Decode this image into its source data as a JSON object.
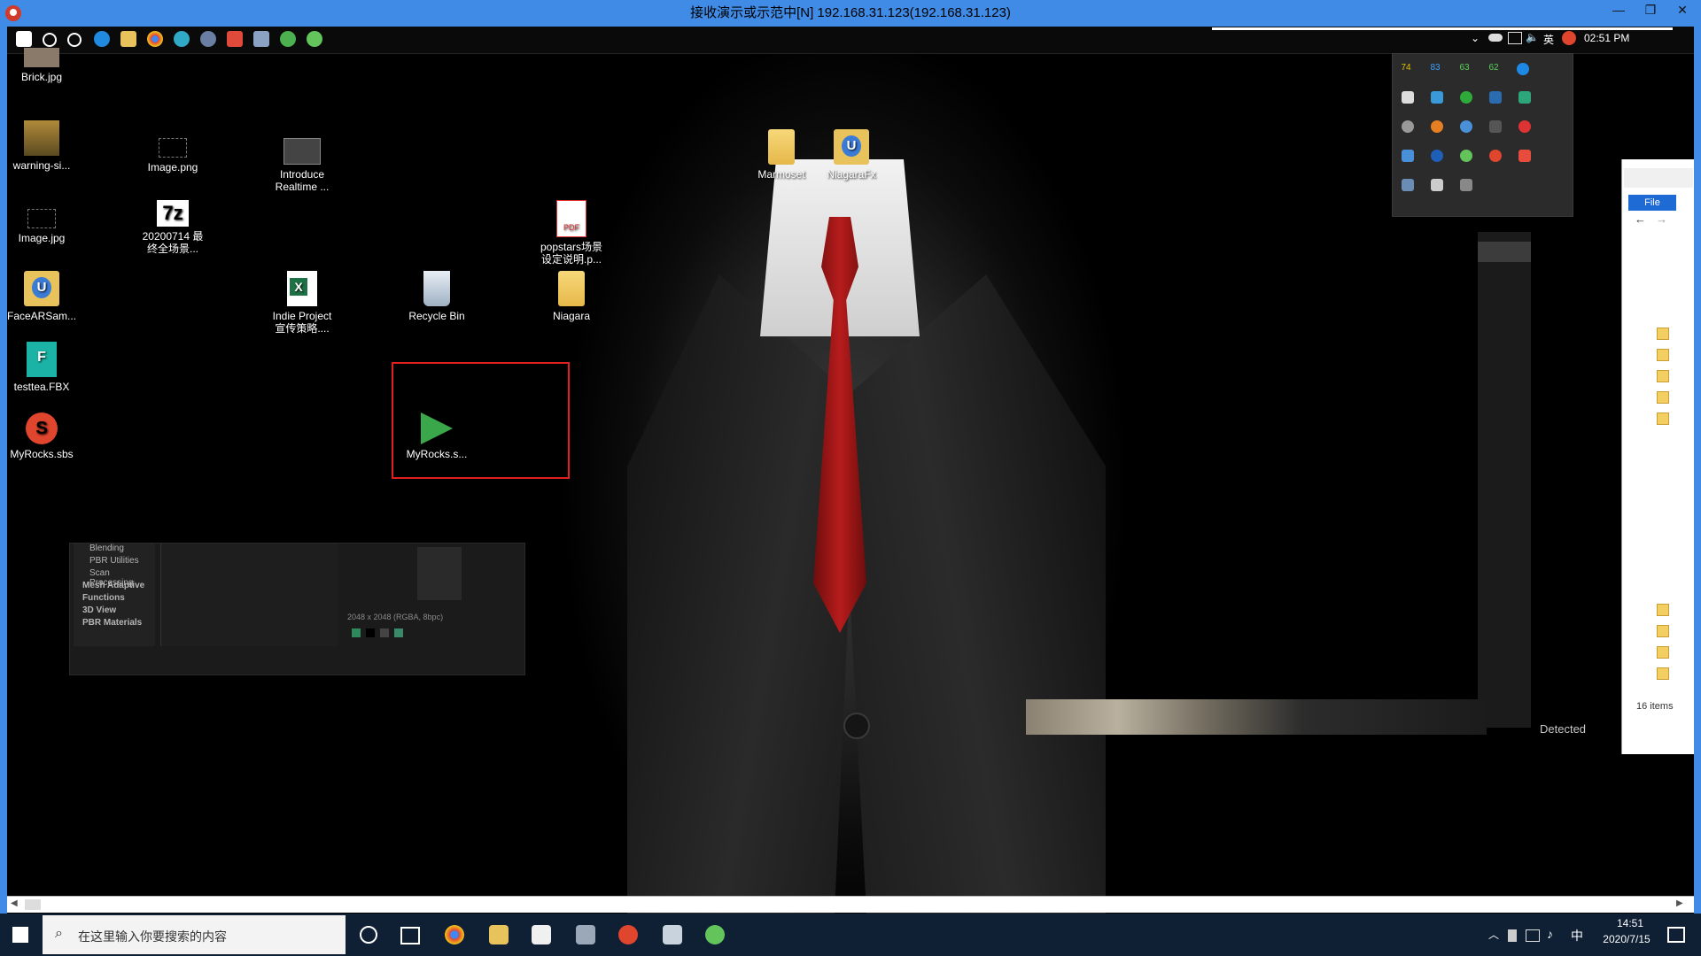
{
  "outer_window": {
    "title": "接收演示或示范中[N] 192.168.31.123(192.168.31.123)"
  },
  "remote_taskbar": {
    "time": "02:51 PM",
    "ime": "英"
  },
  "desktop_icons": [
    {
      "label": "Brick.jpg"
    },
    {
      "label": "warning-si..."
    },
    {
      "label": "Image.png"
    },
    {
      "label": "Introduce Realtime ..."
    },
    {
      "label": "Image.jpg"
    },
    {
      "label": "20200714 最终全场景..."
    },
    {
      "label": "FaceARSam..."
    },
    {
      "label": "Indie Project 宣传策略...."
    },
    {
      "label": "Recycle Bin"
    },
    {
      "label": "Niagara"
    },
    {
      "label": "testtea.FBX"
    },
    {
      "label": "MyRocks.sbs"
    },
    {
      "label": "MyRocks.s..."
    },
    {
      "label": "Marmoset"
    },
    {
      "label": "NiagaraFx"
    },
    {
      "label": "popstars场景设定说明.p..."
    }
  ],
  "tray_panel": {
    "temps": [
      "74",
      "83",
      "63",
      "62"
    ]
  },
  "ghost_window": {
    "items": [
      "Blending",
      "PBR Utilities",
      "Scan Processing",
      "Mesh Adaptive",
      "Functions",
      "3D View",
      "PBR Materials"
    ],
    "resolution": "2048 x 2048 (RGBA, 8bpc)"
  },
  "explorer": {
    "file_tab": "File",
    "items_count": "16 items"
  },
  "right_panel": {
    "detected": "Detected"
  },
  "local_taskbar": {
    "search_placeholder": "在这里输入你要搜索的内容",
    "ime": "中",
    "time": "14:51",
    "date": "2020/7/15"
  }
}
